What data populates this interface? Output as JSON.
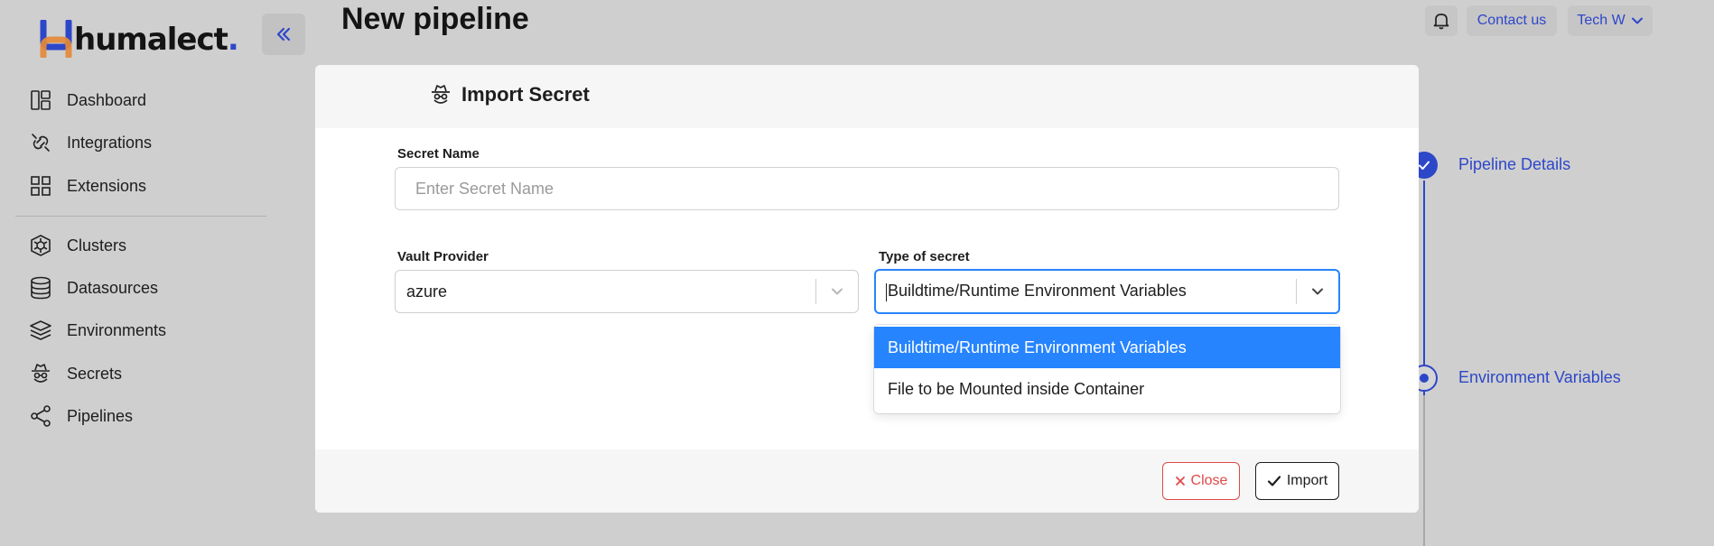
{
  "brand": {
    "name": "humalect",
    "dot": ".",
    "accent": "#2d47c9"
  },
  "sidebar": {
    "items": [
      {
        "label": "Dashboard",
        "icon": "dashboard-icon"
      },
      {
        "label": "Integrations",
        "icon": "integrations-icon"
      },
      {
        "label": "Extensions",
        "icon": "extensions-icon"
      },
      {
        "label": "Clusters",
        "icon": "clusters-icon"
      },
      {
        "label": "Datasources",
        "icon": "database-icon"
      },
      {
        "label": "Environments",
        "icon": "layers-icon"
      },
      {
        "label": "Secrets",
        "icon": "secret-agent-icon"
      },
      {
        "label": "Pipelines",
        "icon": "share-nodes-icon"
      }
    ]
  },
  "header": {
    "title": "New pipeline",
    "contact_label": "Contact us",
    "user_label": "Tech W"
  },
  "stepper": {
    "steps": [
      {
        "label": "Pipeline Details",
        "state": "completed"
      },
      {
        "label": "Environment Variables",
        "state": "active"
      }
    ]
  },
  "modal": {
    "title": "Import Secret",
    "secret_name": {
      "label": "Secret Name",
      "placeholder": "Enter Secret Name",
      "value": ""
    },
    "vault_provider": {
      "label": "Vault Provider",
      "value": "azure"
    },
    "secret_type": {
      "label": "Type of secret",
      "value": "Buildtime/Runtime Environment Variables",
      "options": [
        "Buildtime/Runtime Environment Variables",
        "File to be Mounted inside Container"
      ],
      "highlighted_option_color": "#2684ff"
    },
    "close_label": "Close",
    "import_label": "Import"
  }
}
